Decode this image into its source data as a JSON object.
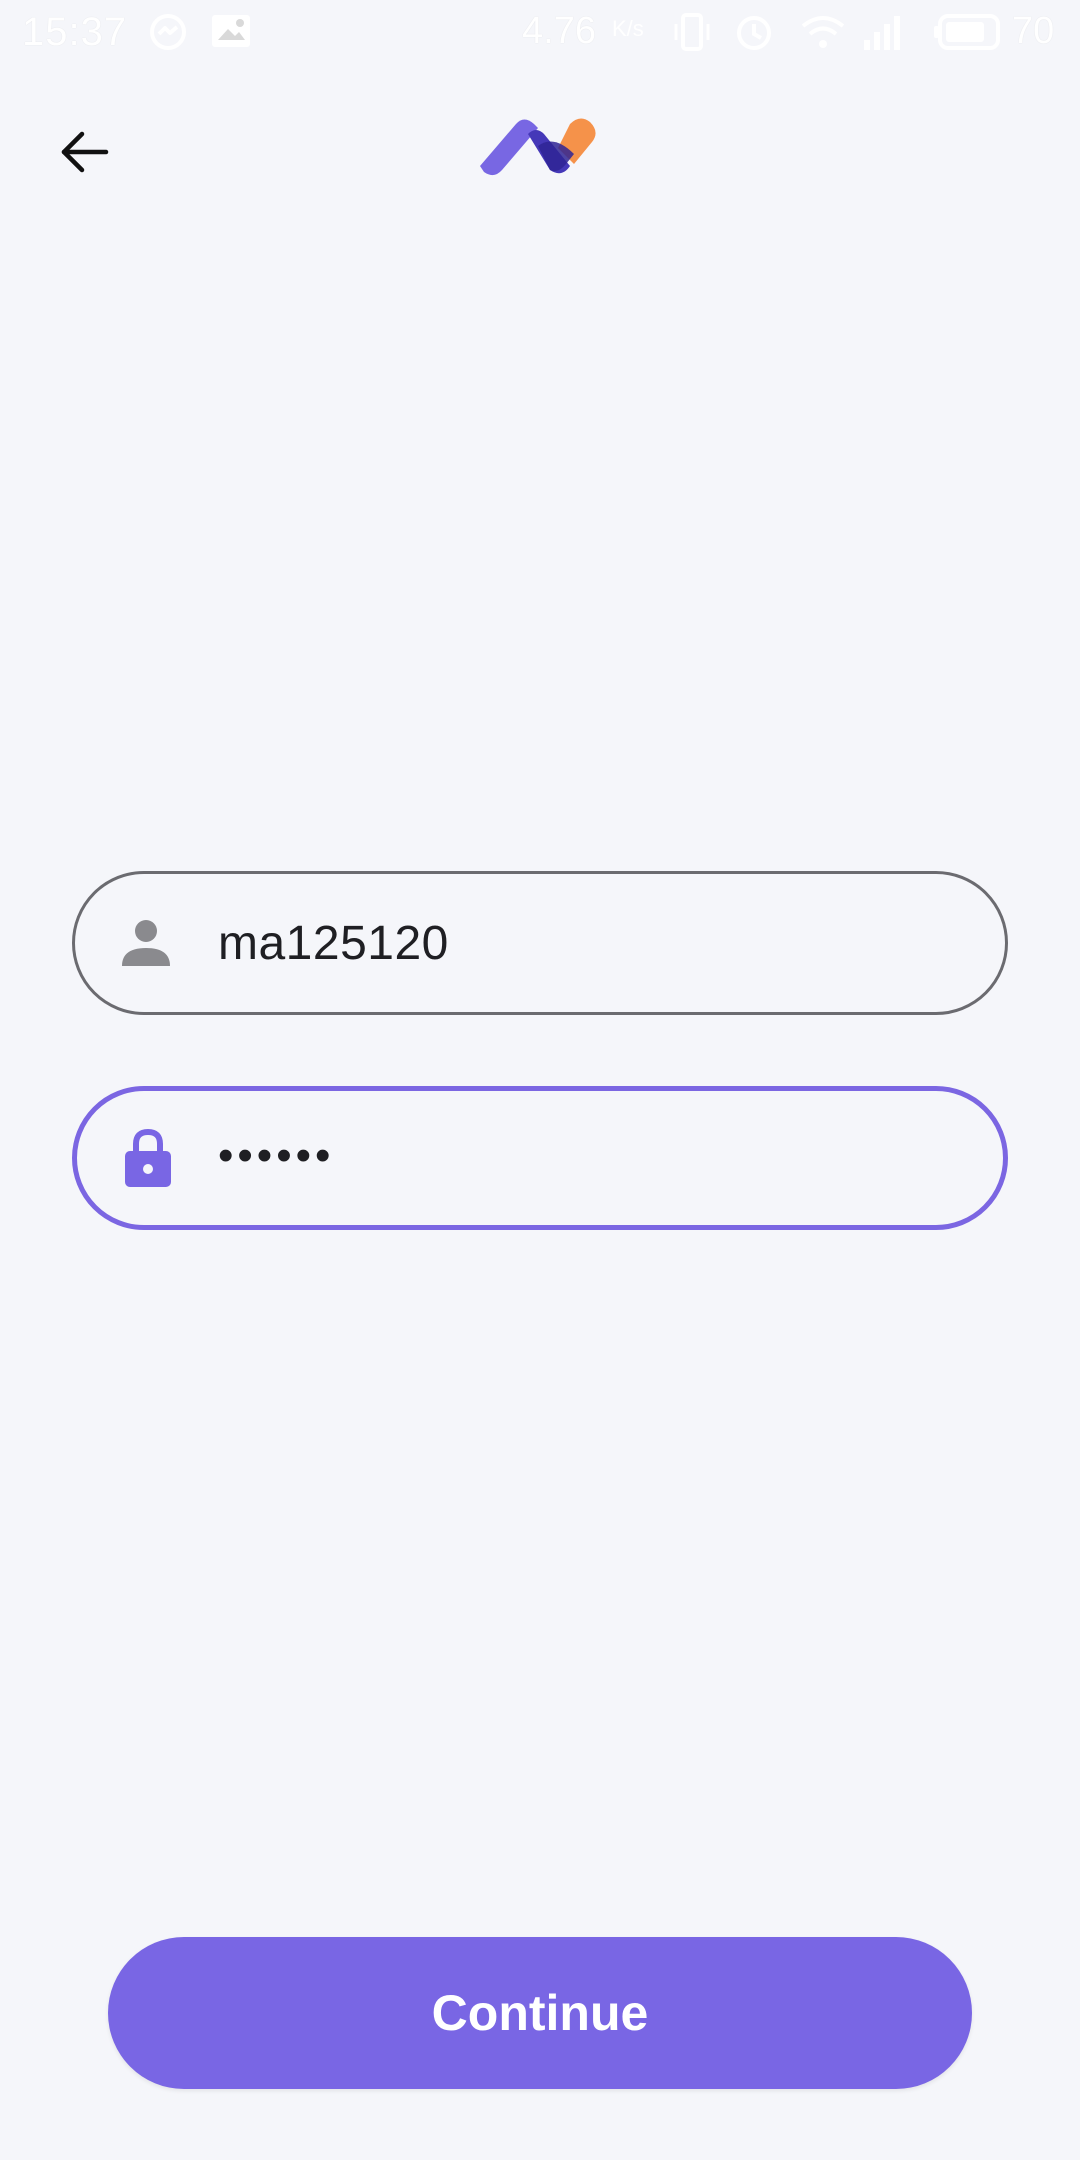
{
  "status_bar": {
    "time": "15:37",
    "network_speed": "4.76",
    "network_speed_unit": "K/s",
    "battery_level": "70",
    "icons": [
      "messenger-icon",
      "image-icon",
      "vibrate-icon",
      "alarm-icon",
      "wifi-icon",
      "signal-icon",
      "battery-icon"
    ]
  },
  "header": {
    "back_icon": "arrow-left-icon",
    "logo_icon": "app-logo-icon"
  },
  "form": {
    "username": {
      "icon": "person-icon",
      "value": "ma125120"
    },
    "password": {
      "icon": "lock-icon",
      "value": "••••••"
    }
  },
  "actions": {
    "continue_label": "Continue"
  },
  "colors": {
    "accent": "#7966e4",
    "accent_border": "#7b66e2",
    "logo_orange": "#f5924a",
    "logo_dark": "#3b2fa6",
    "background": "#f5f6fa"
  }
}
